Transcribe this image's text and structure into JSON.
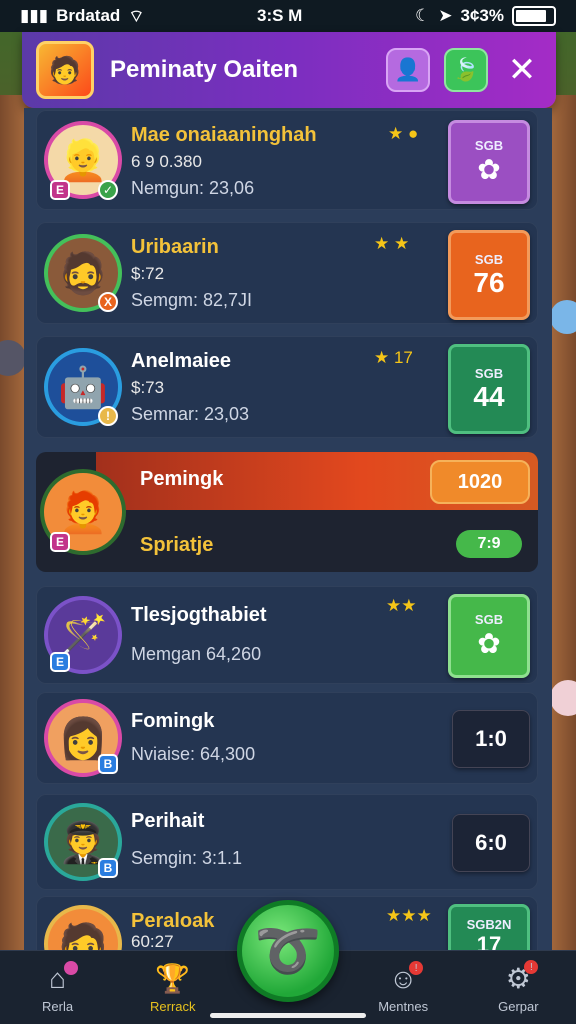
{
  "status_bar": {
    "carrier": "Brdatad",
    "time": "3:S M",
    "battery": "3¢3%"
  },
  "header": {
    "title": "Peminaty Oaiten"
  },
  "rows": [
    {
      "name": "Mae onaiaaninghah",
      "line2": "6 9 0.380",
      "line3": "Nemgun: 23,06",
      "score_label": "SGB",
      "score_value": "",
      "score_color": "#9b4fc2",
      "avatar_color": "#d94aa6",
      "badge": "E",
      "stars": "★ ●"
    },
    {
      "name": "Uribaarin",
      "line2": "$:72",
      "line3": "Semgm: 82,7JI",
      "score_label": "SGB",
      "score_value": "76",
      "score_color": "#e8641e",
      "avatar_color": "#44c05a",
      "badge": "X",
      "stars": "★ ★"
    },
    {
      "name": "Anelmaiee",
      "line2": "$:73",
      "line3": "Semnar: 23,03",
      "score_label": "SGB",
      "score_value": "44",
      "score_color": "#238a55",
      "avatar_color": "#2a9de0",
      "badge": "",
      "stars": "★ 17"
    },
    {
      "name": "Tlesjogthabiet",
      "line2": "",
      "line3": "Memgan 64,260",
      "score_label": "SGB",
      "score_value": "",
      "score_color": "#45b84a",
      "avatar_color": "#7b52c8",
      "badge": "E",
      "stars": "★★"
    },
    {
      "name": "Fomingk",
      "line2": "",
      "line3": "Nviaise: 64,300",
      "score_label": "",
      "score_value": "1:0",
      "score_color": "",
      "avatar_color": "#d94aa6",
      "badge": "B",
      "stars": ""
    },
    {
      "name": "Perihait",
      "line2": "",
      "line3": "Semgin: 3:1.1",
      "score_label": "",
      "score_value": "6:0",
      "score_color": "",
      "avatar_color": "#2aa89a",
      "badge": "B",
      "stars": ""
    },
    {
      "name": "Peraloak",
      "line2": "60:27",
      "line3": "",
      "score_label": "SGB2N",
      "score_value": "17",
      "score_color": "#238a55",
      "avatar_color": "#e8b84a",
      "badge": "",
      "stars": "★★★"
    }
  ],
  "highlight_row": {
    "title": "Pemingk",
    "score": "1020",
    "subtitle": "Spriatje",
    "badge_value": "7:9"
  },
  "bottom_nav": {
    "items": [
      {
        "label": "Rerla",
        "icon": "home-icon"
      },
      {
        "label": "Rerrack",
        "icon": "leaderboard-icon"
      },
      {
        "label": "Mentnes",
        "icon": "mentors-icon"
      },
      {
        "label": "Gerpar",
        "icon": "gear-icon"
      }
    ]
  }
}
